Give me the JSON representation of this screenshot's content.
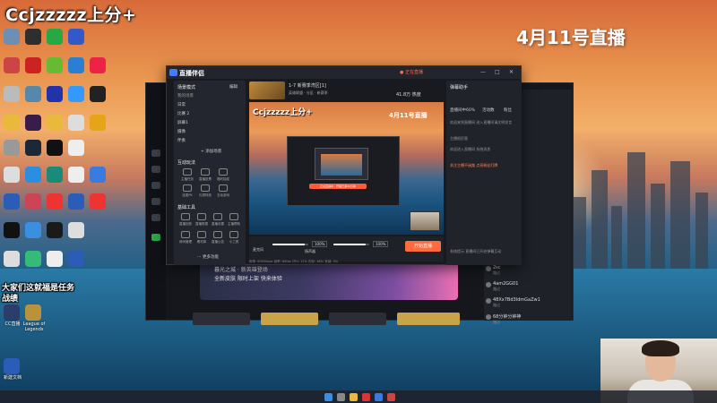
{
  "overlay": {
    "stream_title": "Ccjzzzzz上分+",
    "date_title": "4月11号直播",
    "side_text_line1": "大家们这就福是任务",
    "side_text_line2": "战绩"
  },
  "desktop_icons": [
    {
      "name": "recycle-bin-icon",
      "color": "#7aa2c8",
      "label": ""
    },
    {
      "name": "game-icon",
      "color": "#3a3a3a",
      "label": ""
    },
    {
      "name": "app-green-icon",
      "color": "#2aa84a",
      "label": ""
    },
    {
      "name": "app-blue-icon",
      "color": "#3355cc",
      "label": ""
    }
  ],
  "desktop_labels": {
    "lol": "League of Legends",
    "cc": "CC直播",
    "doc": "新建文档"
  },
  "app": {
    "title": "直播伴侣",
    "live_status": "● 正在直播",
    "min": "—",
    "max": "□",
    "close": "✕"
  },
  "header": {
    "stream_name": "1-7 新赛季湾区[1]",
    "category": "英雄联盟 · 分区 · 新赛季",
    "viewers": "41.8万 热度"
  },
  "scenes": {
    "header": "场景模式",
    "header_right": "编辑",
    "my_scenes": "我的场景",
    "items": [
      "日常",
      "比赛 2",
      "屏幕1",
      "摄像",
      "伴奏"
    ],
    "add": "+ 添加场景"
  },
  "tools_top": {
    "header": "互动玩法",
    "items": [
      "主播任务",
      "直播投票",
      "福利抽奖",
      "连麦PK",
      "礼物特效",
      "互动游戏",
      "弹幕抽奖",
      "粉丝团"
    ]
  },
  "tools_bottom": {
    "header": "基础工具",
    "items": [
      "直播回放",
      "直播数据",
      "直播设置",
      "主播帮助",
      "房间管理",
      "素材库",
      "直播公告",
      "小工具"
    ]
  },
  "more_tools": "⋯ 更多功能",
  "preview": {
    "overlay_title": "Ccjzzzzz上分+",
    "overlay_date": "4月11号直播",
    "banner": "正在直播中 · 开播已满30分钟"
  },
  "controls": {
    "mic_label": "麦克风",
    "mic_pct": "100%",
    "speaker_label": "扬声器",
    "speaker_pct": "100%",
    "start_button": "开始直播",
    "mic_level": 0.9,
    "speaker_level": 0.9
  },
  "statusbar": "码率: 6000kbps   帧率: 60fps   CPU: 12%   内存: 48%   丢帧: 0%",
  "assistant": {
    "title": "弹幕助手",
    "tabs": [
      "直播间中60%",
      "活动数",
      "粉丝"
    ],
    "lines": [
      "欢迎来到直播间 进入直播间请文明发言",
      "主播很厉害",
      "欢迎进入直播间 系统消息",
      "关注主播不迷路 点亮粉丝灯牌",
      "系统提示 直播间已开启弹幕互动"
    ]
  },
  "back_window": {
    "banner_line1": "暮光之城 · 新英雄登场",
    "banner_line2": "全新皮肤 限时上架 快来体验",
    "chat_users": [
      {
        "name": "2sc",
        "msg": "路过"
      },
      {
        "name": "4am2GG01",
        "msg": "路过"
      },
      {
        "name": "48Xx7Bd3ldmGaZw1",
        "msg": "路过"
      },
      {
        "name": "68分钟分钟神",
        "msg": "路过"
      }
    ]
  }
}
